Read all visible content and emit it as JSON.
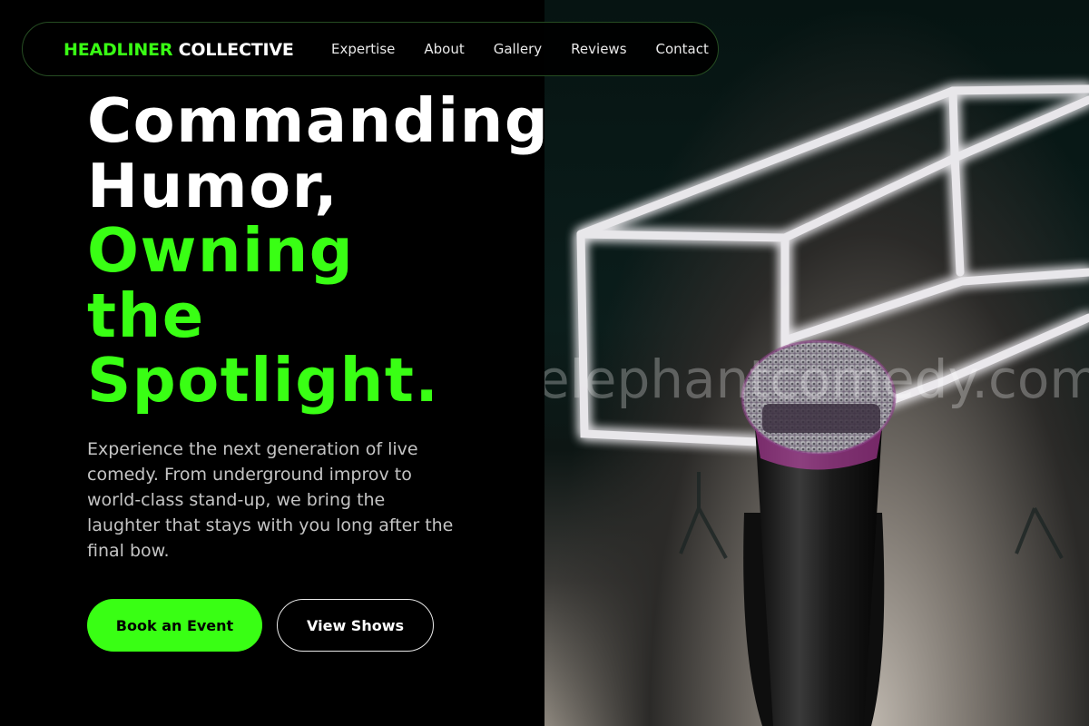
{
  "colors": {
    "accent": "#39ff14",
    "background": "#000000",
    "text": "#ffffff",
    "muted_text": "#c4c4c4"
  },
  "nav": {
    "brand_part1": "HEADLINER",
    "brand_part2": "COLLECTIVE",
    "links": [
      "Expertise",
      "About",
      "Gallery",
      "Reviews",
      "Contact"
    ]
  },
  "hero": {
    "headline_white": [
      "Commanding",
      "Humor,"
    ],
    "headline_green": [
      "Owning",
      "the",
      "Spotlight."
    ],
    "description": "Experience the next generation of live comedy. From underground improv to world-class stand-up, we bring the laughter that stays with you long after the final bow.",
    "primary_button": "Book an Event",
    "secondary_button": "View Shows"
  },
  "image": {
    "description_icon": "microphone-neon-stage-photo",
    "watermark": "elephantcomedy.com"
  }
}
